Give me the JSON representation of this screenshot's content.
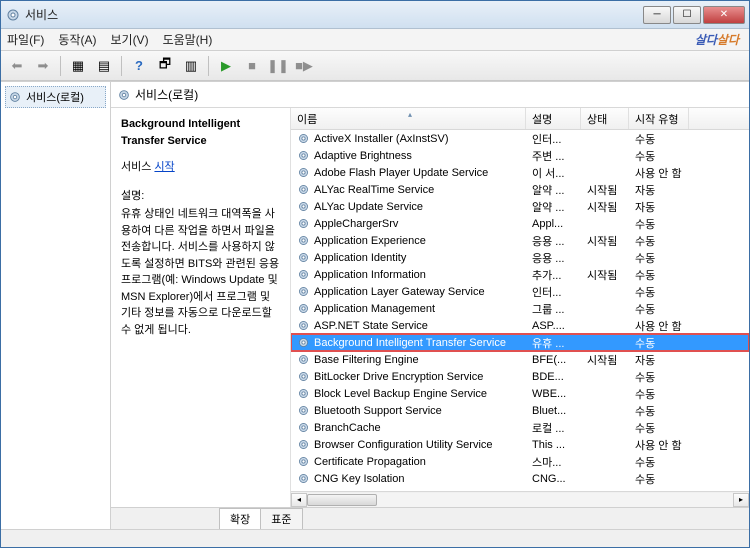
{
  "window": {
    "title": "서비스"
  },
  "menubar": {
    "file": "파일(F)",
    "action": "동작(A)",
    "view": "보기(V)",
    "help": "도움말(H)"
  },
  "watermark": {
    "part1": "살다",
    "part2": "살다"
  },
  "tree": {
    "root": "서비스(로컬)"
  },
  "main_header": "서비스(로컬)",
  "detail": {
    "service_name": "Background Intelligent Transfer Service",
    "prefix": "서비스",
    "link_start": "시작",
    "desc_label": "설명:",
    "desc_body": "유휴 상태인 네트워크 대역폭을 사용하여 다른 작업을 하면서 파일을 전송합니다. 서비스를 사용하지 않도록 설정하면 BITS와 관련된 응용 프로그램(예: Windows Update 및 MSN Explorer)에서 프로그램 및 기타 정보를 자동으로 다운로드할 수 없게 됩니다."
  },
  "columns": {
    "name": "이름",
    "desc": "설명",
    "status": "상태",
    "start": "시작 유형"
  },
  "services": [
    {
      "name": "ActiveX Installer (AxInstSV)",
      "desc": "인터...",
      "status": "",
      "start": "수동"
    },
    {
      "name": "Adaptive Brightness",
      "desc": "주변 ...",
      "status": "",
      "start": "수동"
    },
    {
      "name": "Adobe Flash Player Update Service",
      "desc": "이 서...",
      "status": "",
      "start": "사용 안 함"
    },
    {
      "name": "ALYac RealTime Service",
      "desc": "알약 ...",
      "status": "시작됨",
      "start": "자동"
    },
    {
      "name": "ALYac Update Service",
      "desc": "알약 ...",
      "status": "시작됨",
      "start": "자동"
    },
    {
      "name": "AppleChargerSrv",
      "desc": "Appl...",
      "status": "",
      "start": "수동"
    },
    {
      "name": "Application Experience",
      "desc": "응용 ...",
      "status": "시작됨",
      "start": "수동"
    },
    {
      "name": "Application Identity",
      "desc": "응용 ...",
      "status": "",
      "start": "수동"
    },
    {
      "name": "Application Information",
      "desc": "추가...",
      "status": "시작됨",
      "start": "수동"
    },
    {
      "name": "Application Layer Gateway Service",
      "desc": "인터...",
      "status": "",
      "start": "수동"
    },
    {
      "name": "Application Management",
      "desc": "그룹 ...",
      "status": "",
      "start": "수동"
    },
    {
      "name": "ASP.NET State Service",
      "desc": "ASP....",
      "status": "",
      "start": "사용 안 함"
    },
    {
      "name": "Background Intelligent Transfer Service",
      "desc": "유휴 ...",
      "status": "",
      "start": "수동",
      "selected": true,
      "highlighted": true
    },
    {
      "name": "Base Filtering Engine",
      "desc": "BFE(...",
      "status": "시작됨",
      "start": "자동"
    },
    {
      "name": "BitLocker Drive Encryption Service",
      "desc": "BDE...",
      "status": "",
      "start": "수동"
    },
    {
      "name": "Block Level Backup Engine Service",
      "desc": "WBE...",
      "status": "",
      "start": "수동"
    },
    {
      "name": "Bluetooth Support Service",
      "desc": "Bluet...",
      "status": "",
      "start": "수동"
    },
    {
      "name": "BranchCache",
      "desc": "로컬 ...",
      "status": "",
      "start": "수동"
    },
    {
      "name": "Browser Configuration Utility Service",
      "desc": "This ...",
      "status": "",
      "start": "사용 안 함"
    },
    {
      "name": "Certificate Propagation",
      "desc": "스마...",
      "status": "",
      "start": "수동"
    },
    {
      "name": "CNG Key Isolation",
      "desc": "CNG...",
      "status": "",
      "start": "수동"
    }
  ],
  "tabs": {
    "extended": "확장",
    "standard": "표준"
  }
}
